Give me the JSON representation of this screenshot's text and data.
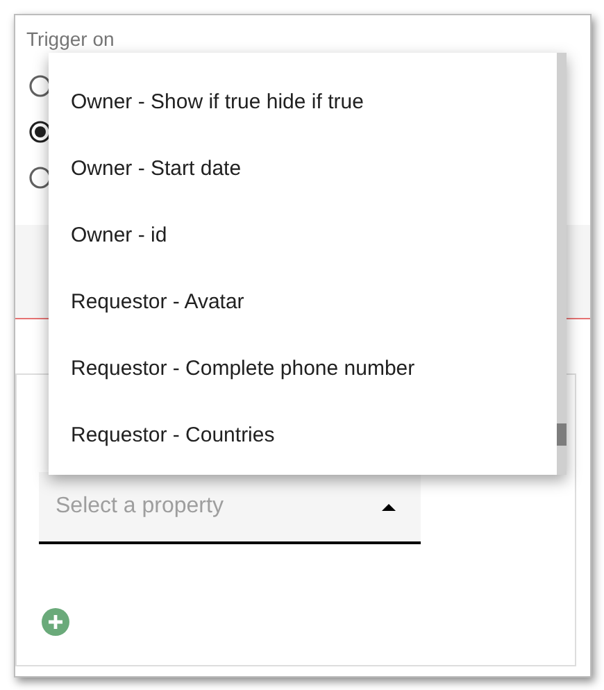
{
  "trigger": {
    "label": "Trigger on",
    "options": [
      {
        "selected": false
      },
      {
        "selected": true
      },
      {
        "selected": false
      }
    ]
  },
  "mapping": {
    "select": {
      "placeholder": "Select a property"
    }
  },
  "dropdown": {
    "items": [
      {
        "label": "Owner - Show if true hide if true"
      },
      {
        "label": "Owner - Start date"
      },
      {
        "label": "Owner - id"
      },
      {
        "label": "Requestor - Avatar"
      },
      {
        "label": "Requestor - Complete phone number"
      },
      {
        "label": "Requestor - Countries"
      }
    ]
  }
}
